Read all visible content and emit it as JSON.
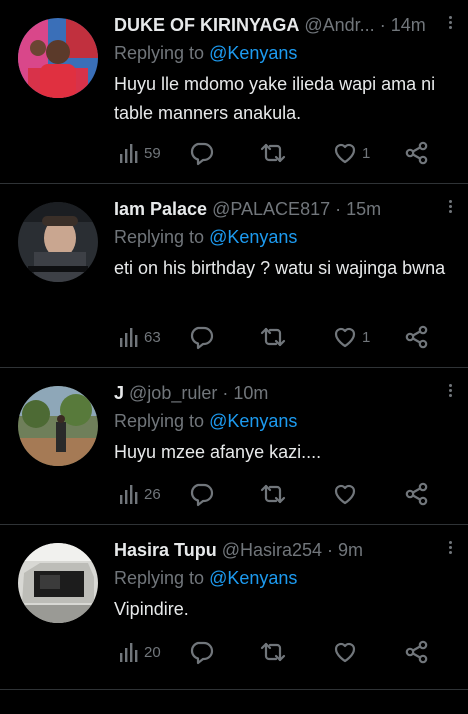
{
  "tweets": [
    {
      "name": "DUKE OF KIRINYAGA",
      "handle": "@Andr...",
      "time": "· 14m",
      "reply_prefix": "Replying to",
      "reply_to": "@Kenyans",
      "text": "Huyu lle mdomo yake ilieda wapi ama ni table manners anakula.",
      "views": "59",
      "likes": "1"
    },
    {
      "name": "Iam Palace",
      "handle": "@PALACE817",
      "time": "· 15m",
      "reply_prefix": "Replying to",
      "reply_to": "@Kenyans",
      "text": "eti on his birthday ? watu si wajinga bwna",
      "views": "63",
      "likes": "1"
    },
    {
      "name": "J",
      "handle": "@job_ruler",
      "time": "· 10m",
      "reply_prefix": "Replying to",
      "reply_to": "@Kenyans",
      "text": "Huyu mzee afanye kazi....",
      "views": "26",
      "likes": ""
    },
    {
      "name": "Hasira Tupu",
      "handle": "@Hasira254",
      "time": "· 9m",
      "reply_prefix": "Replying to",
      "reply_to": "@Kenyans",
      "text": "Vipindire.",
      "views": "20",
      "likes": ""
    }
  ],
  "icons": {
    "views": "views-icon",
    "reply": "reply-icon",
    "retweet": "retweet-icon",
    "like": "like-icon",
    "share": "share-icon",
    "more": "more-icon"
  },
  "colors": {
    "background": "#000000",
    "text": "#e7e9ea",
    "muted": "#71767b",
    "link": "#1d9bf0",
    "divider": "#2f3336"
  }
}
